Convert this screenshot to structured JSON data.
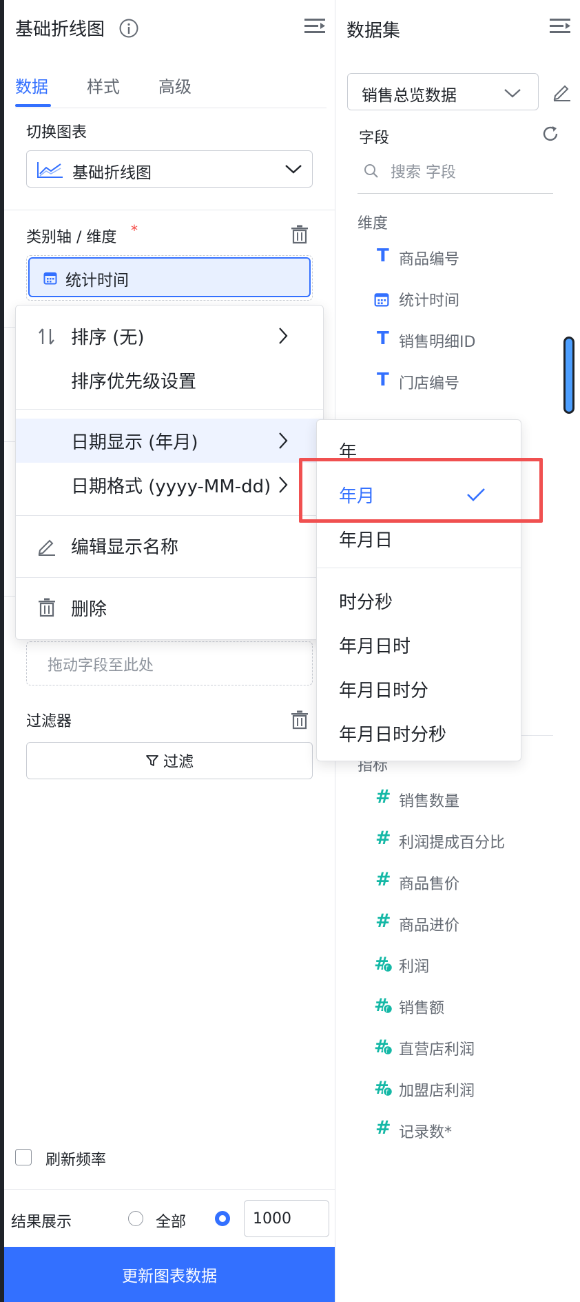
{
  "left_panel": {
    "title": "基础折线图",
    "tabs": [
      "数据",
      "样式",
      "高级"
    ],
    "active_tab": "数据",
    "switch_chart": {
      "label": "切换图表",
      "selected": "基础折线图"
    },
    "category_axis": {
      "label": "类别轴 / 维度",
      "required_mark": "*",
      "field": "统计时间"
    },
    "drop_placeholder": "拖动字段至此处",
    "filter": {
      "label": "过滤器",
      "button": "过滤"
    },
    "refresh": {
      "label": "刷新频率",
      "checked": false
    },
    "result_display": {
      "label": "结果展示",
      "option_all": "全部",
      "limit_value": "1000",
      "selected": "limit"
    },
    "update_button": "更新图表数据"
  },
  "right_panel": {
    "title": "数据集",
    "dataset_select": "销售总览数据",
    "fields_label": "字段",
    "search_placeholder": "搜索 字段",
    "dimension_label": "维度",
    "dimensions": [
      {
        "icon": "text-type-icon",
        "name": "商品编号"
      },
      {
        "icon": "date-type-icon",
        "name": "统计时间"
      },
      {
        "icon": "text-type-icon",
        "name": "销售明细ID"
      },
      {
        "icon": "text-type-icon",
        "name": "门店编号"
      }
    ],
    "metric_label": "指标",
    "metrics": [
      {
        "icon": "number-type-icon",
        "name": "销售数量"
      },
      {
        "icon": "number-type-icon",
        "name": "利润提成百分比"
      },
      {
        "icon": "number-type-icon",
        "name": "商品售价"
      },
      {
        "icon": "number-type-icon",
        "name": "商品进价"
      },
      {
        "icon": "calc-number-type-icon",
        "name": "利润"
      },
      {
        "icon": "calc-number-type-icon",
        "name": "销售额"
      },
      {
        "icon": "calc-number-type-icon",
        "name": "直营店利润"
      },
      {
        "icon": "calc-number-type-icon",
        "name": "加盟店利润"
      },
      {
        "icon": "number-type-icon",
        "name": "记录数*"
      }
    ]
  },
  "context_menu": {
    "sort": "排序 (无)",
    "sort_priority": "排序优先级设置",
    "date_display": "日期显示 (年月)",
    "date_format": "日期格式 (yyyy-MM-dd)",
    "edit_display_name": "编辑显示名称",
    "delete": "删除"
  },
  "date_submenu": {
    "options": [
      "年",
      "年月",
      "年月日",
      "时分秒",
      "年月日时",
      "年月日时分",
      "年月日时分秒"
    ],
    "selected": "年月"
  },
  "colors": {
    "accent": "#3370ff",
    "highlight_frame": "#f05050",
    "metric_icon": "#14b8a6"
  }
}
